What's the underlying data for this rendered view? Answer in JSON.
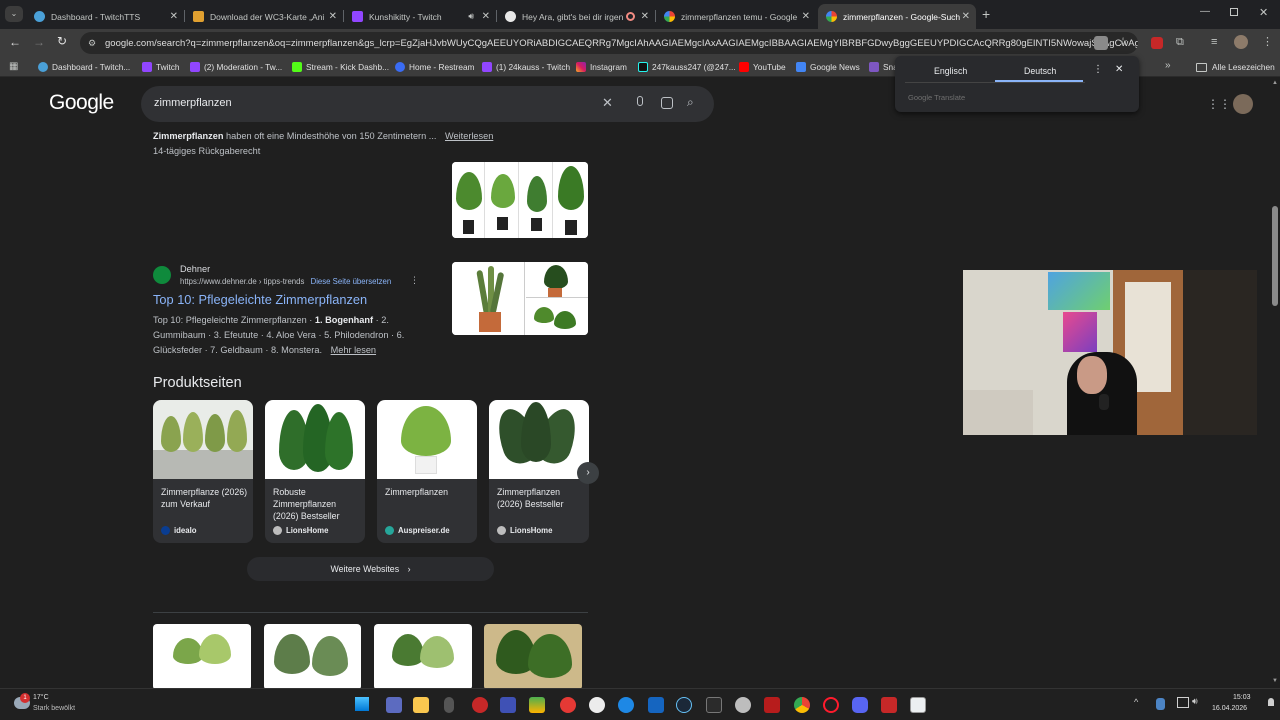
{
  "tabs": [
    {
      "label": "Dashboard - TwitchTTS",
      "active": false
    },
    {
      "label": "Download der WC3-Karte „Ani",
      "active": false
    },
    {
      "label": "Kunshikitty - Twitch",
      "active": false
    },
    {
      "label": "Hey Ara, gibt's bei dir irgen",
      "active": false
    },
    {
      "label": "zimmerpflanzen temu - Google",
      "active": false
    },
    {
      "label": "zimmerpflanzen - Google-Such",
      "active": true
    }
  ],
  "url": "google.com/search?q=zimmerpflanzen&oq=zimmerpflanzen&gs_lcrp=EgZjaHJvbWUyCQgAEEUYORiABDIGCAEQRRg7MgcIAhAAGIAEMgcIAxAAGIAEMgcIBBAAGIAEMgYIBRBFGDwyBggGEEUYPDIGCAcQRRg80gEINTI5NWowajSoAgCwAgE...",
  "bookmarks": [
    "Dashboard - Twitch...",
    "Twitch",
    "(2) Moderation - Tw...",
    "Stream - Kick Dashb...",
    "Home - Restream",
    "(1) 24kauss - Twitch",
    "Instagram",
    "247kauss247 (@247...",
    "YouTube",
    "Google News",
    "Sna",
    "Alle Lesezeichen"
  ],
  "translate": {
    "lang_from": "Englisch",
    "lang_to": "Deutsch",
    "brand": "Google Translate"
  },
  "google": {
    "logo": "Google",
    "query": "zimmerpflanzen"
  },
  "snippet1": {
    "bold": "Zimmerpflanzen",
    "text": " haben oft eine Mindesthöhe von 150 Zentimetern ...",
    "more": "Weiterlesen",
    "sub": "14-tägiges Rückgaberecht"
  },
  "result2": {
    "site": "Dehner",
    "url": "https://www.dehner.de › tipps-trends",
    "translate_link": "Diese Seite übersetzen",
    "title": "Top 10: Pflegeleichte Zimmerpflanzen",
    "line1_a": "Top 10: Pflegeleichte Zimmerpflanzen · ",
    "line1_bold": "1. Bogenhanf",
    "line1_b": " · 2.",
    "line2": "Gummibaum · 3. Efeutute · 4. Aloe Vera · 5. Philodendron · 6.",
    "line3": "Glücksfeder · 7. Geldbaum · 8. Monstera.",
    "more": "Mehr lesen"
  },
  "products": {
    "heading": "Produktseiten",
    "items": [
      {
        "title": "Zimmerpflanze (2026) zum Verkauf",
        "source": "idealo"
      },
      {
        "title": "Robuste Zimmerpflanzen (2026) Bestseller",
        "source": "LionsHome"
      },
      {
        "title": "Zimmerpflanzen",
        "source": "Auspreiser.de"
      },
      {
        "title": "Zimmerpflanzen (2026) Bestseller",
        "source": "LionsHome"
      }
    ],
    "more_button": "Weitere Websites"
  },
  "taskbar": {
    "weather_temp": "17°C",
    "weather_text": "Stark bewölkt",
    "notification_count": "1",
    "time": "15:03",
    "date": "16.04.2026"
  },
  "colors": {
    "link": "#8ab4f8",
    "page_bg": "#1f1f1f",
    "tab_active": "#3c3c3c"
  }
}
